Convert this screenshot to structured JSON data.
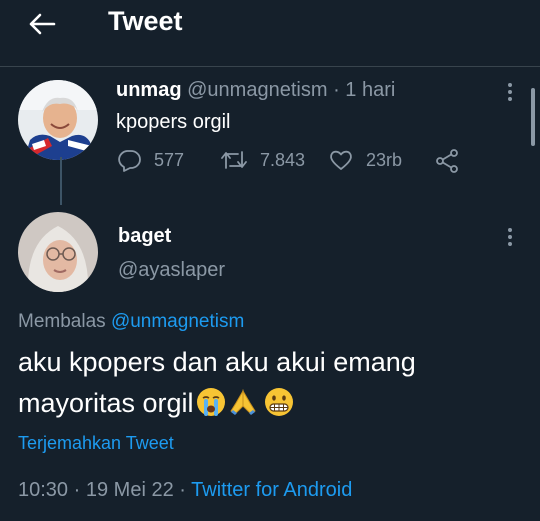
{
  "header": {
    "title": "Tweet"
  },
  "parent_tweet": {
    "display_name": "unmag",
    "handle": "@unmagnetism",
    "separator": "·",
    "time": "1 hari",
    "text": "kpopers orgil",
    "stats": {
      "replies": "577",
      "retweets": "7.843",
      "likes": "23rb"
    }
  },
  "reply_tweet": {
    "display_name": "baget",
    "handle": "@ayaslaper",
    "replying_label": "Membalas",
    "replying_to": "@unmagnetism",
    "text_line1": "aku kpopers dan aku akui emang",
    "text_line2": "mayoritas orgil",
    "emojis": [
      "loudly-crying-face",
      "folded-hands",
      "grimacing-face"
    ],
    "translate_label": "Terjemahkan Tweet",
    "time": "10:30",
    "date": "19 Mei 22",
    "source": "Twitter for Android"
  },
  "colors": {
    "background": "#15202b",
    "accent": "#1d9bf0",
    "secondary_text": "#8b98a5",
    "divider": "#38444d"
  }
}
